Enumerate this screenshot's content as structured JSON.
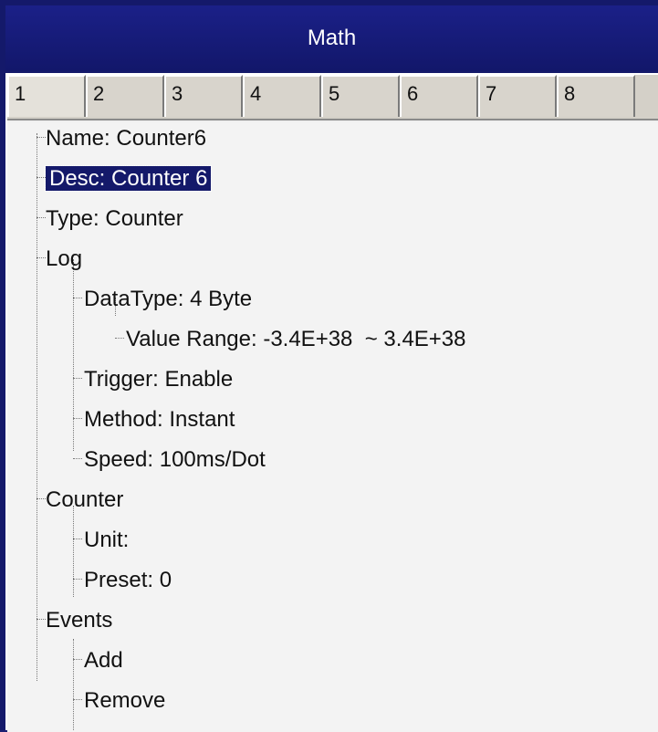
{
  "window": {
    "title": "Math"
  },
  "tabs": [
    "1",
    "2",
    "3",
    "4",
    "5",
    "6",
    "7",
    "8"
  ],
  "active_tab": "1",
  "tree": {
    "name": "Name: Counter6",
    "desc": "Desc: Counter 6",
    "type": "Type: Counter",
    "log": "Log",
    "datatype": "DataType: 4 Byte",
    "value_range": "Value Range: -3.4E+38  ~ 3.4E+38",
    "trigger": "Trigger: Enable",
    "method": "Method: Instant",
    "speed": "Speed: 100ms/Dot",
    "counter": "Counter",
    "unit": "Unit:",
    "preset": "Preset: 0",
    "events": "Events",
    "add": "Add",
    "remove": "Remove"
  }
}
